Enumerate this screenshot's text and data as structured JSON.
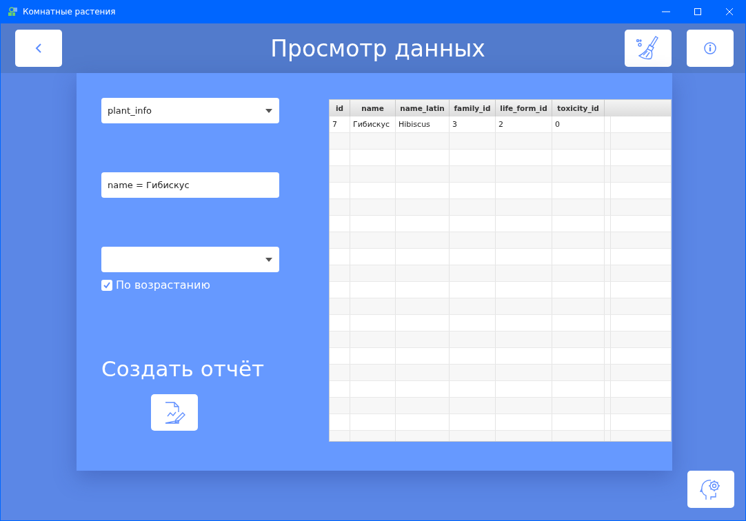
{
  "window": {
    "title": "Комнатные растения"
  },
  "header": {
    "title": "Просмотр данных"
  },
  "table_select": {
    "value": "plant_info"
  },
  "filter_field": {
    "value": "name = Гибискус"
  },
  "ascending": {
    "label": "По возрастанию",
    "checked": true
  },
  "report": {
    "title": "Создать отчёт"
  },
  "table": {
    "columns": [
      "id",
      "name",
      "name_latin",
      "family_id",
      "life_form_id",
      "toxicity_id"
    ],
    "rows": [
      [
        "7",
        "Гибискус",
        "Hibiscus",
        "3",
        "2",
        "0"
      ]
    ]
  }
}
